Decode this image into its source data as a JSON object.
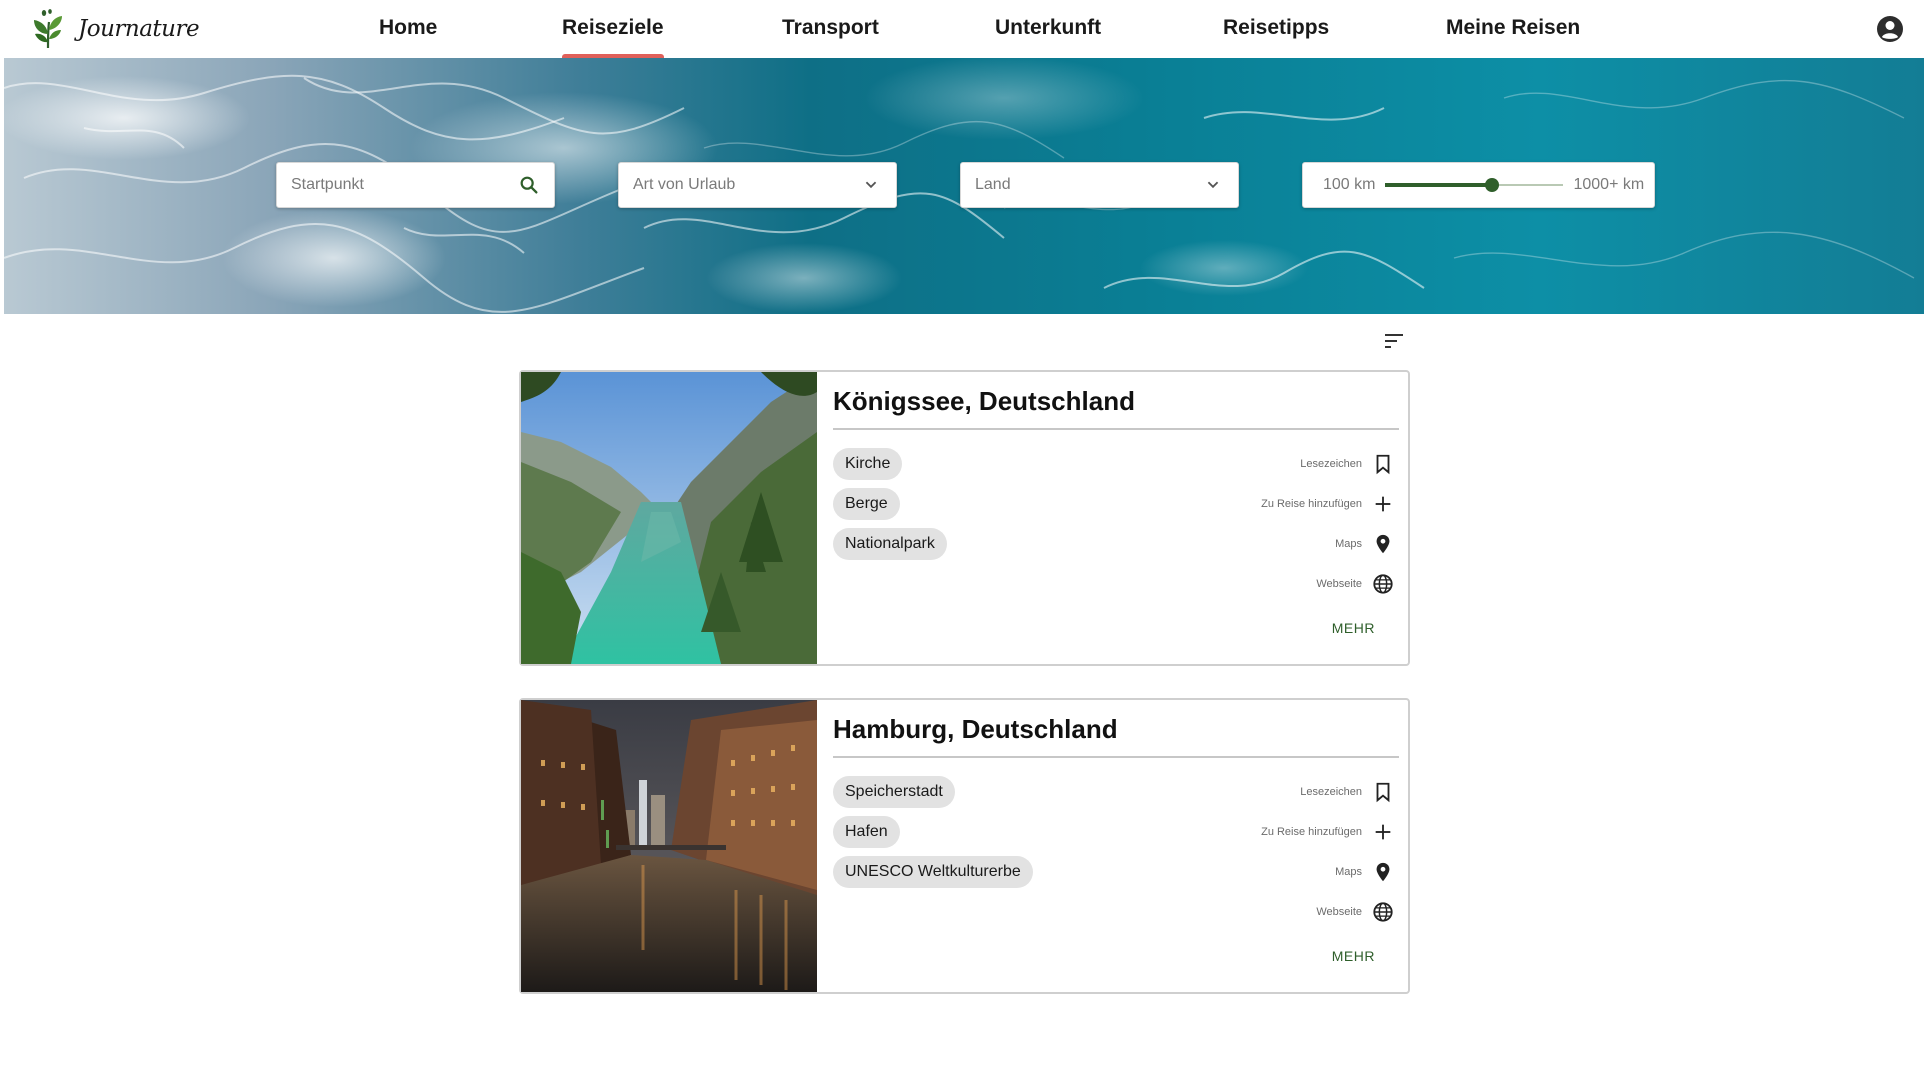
{
  "brand": {
    "name": "Journature",
    "logo_icon": "leaf-footprint-logo"
  },
  "nav": {
    "items": [
      {
        "label": "Home",
        "active": false
      },
      {
        "label": "Reiseziele",
        "active": true
      },
      {
        "label": "Transport",
        "active": false
      },
      {
        "label": "Unterkunft",
        "active": false
      },
      {
        "label": "Reisetipps",
        "active": false
      },
      {
        "label": "Meine Reisen",
        "active": false
      }
    ],
    "account_icon": "account-circle-icon",
    "active_indicator_color": "#e0605a"
  },
  "filters": {
    "start": {
      "placeholder": "Startpunkt",
      "icon": "search-icon"
    },
    "vacation_type": {
      "placeholder": "Art von Urlaub",
      "icon": "chevron-down-icon"
    },
    "country": {
      "placeholder": "Land",
      "icon": "chevron-down-icon"
    },
    "distance": {
      "min_label": "100 km",
      "max_label": "1000+ km",
      "value_fraction": 0.6
    }
  },
  "sort_icon": "sort-icon",
  "accent_color": "#2f5f2b",
  "results": [
    {
      "title": "Königssee, Deutschland",
      "image": "koenigssee-lake-photo",
      "tags": [
        "Kirche",
        "Berge",
        "Nationalpark"
      ],
      "actions": [
        {
          "label": "Lesezeichen",
          "icon": "bookmark-icon"
        },
        {
          "label": "Zu Reise hinzufügen",
          "icon": "plus-icon"
        },
        {
          "label": "Maps",
          "icon": "map-pin-icon"
        },
        {
          "label": "Webseite",
          "icon": "globe-icon"
        }
      ],
      "more_label": "MEHR"
    },
    {
      "title": "Hamburg, Deutschland",
      "image": "hamburg-speicherstadt-photo",
      "tags": [
        "Speicherstadt",
        "Hafen",
        "UNESCO Weltkulturerbe"
      ],
      "actions": [
        {
          "label": "Lesezeichen",
          "icon": "bookmark-icon"
        },
        {
          "label": "Zu Reise hinzufügen",
          "icon": "plus-icon"
        },
        {
          "label": "Maps",
          "icon": "map-pin-icon"
        },
        {
          "label": "Webseite",
          "icon": "globe-icon"
        }
      ],
      "more_label": "MEHR"
    }
  ]
}
